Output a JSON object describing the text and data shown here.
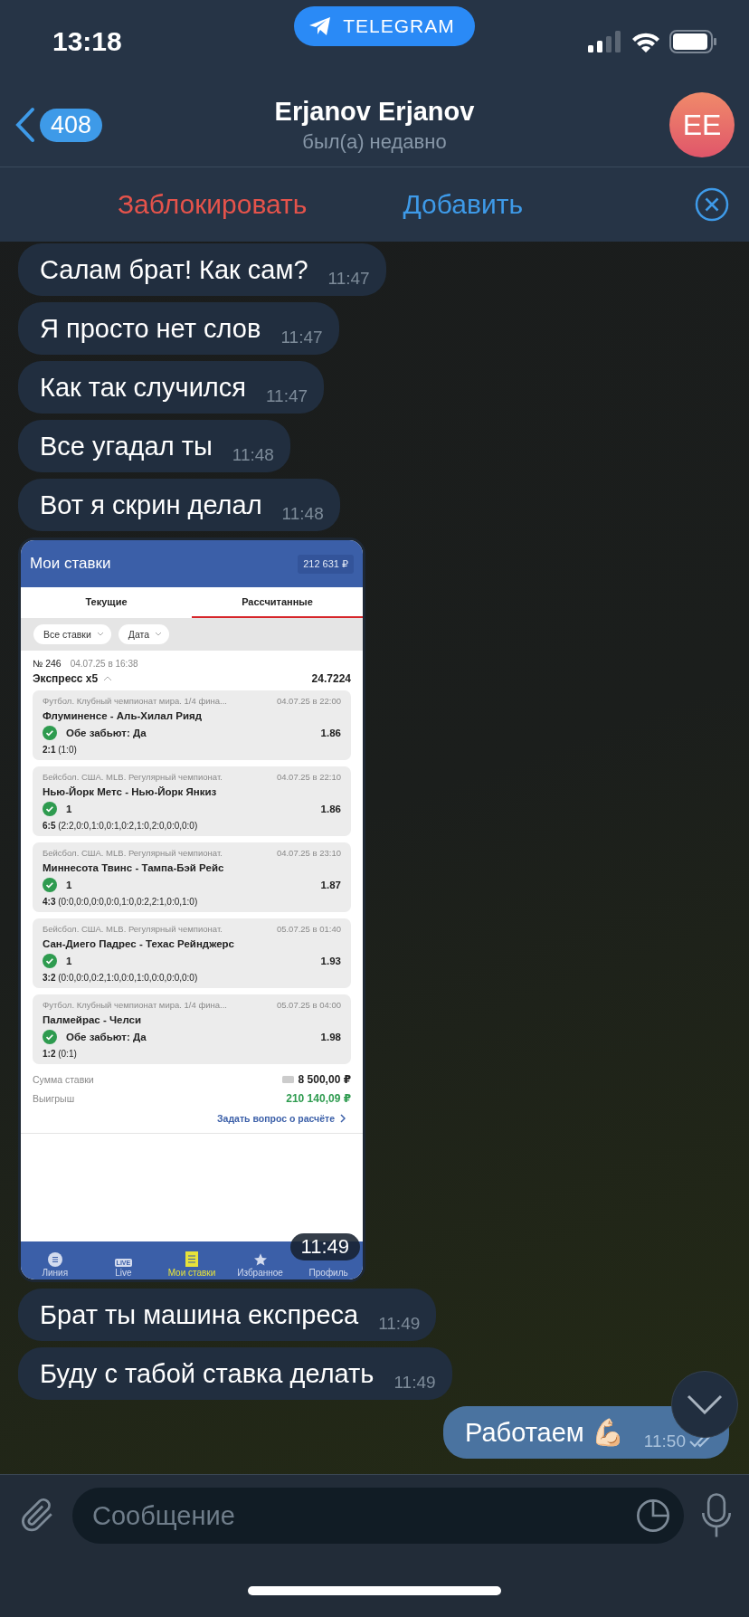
{
  "status_bar": {
    "time": "13:18",
    "app_pill": "TELEGRAM"
  },
  "header": {
    "back_count": "408",
    "name": "Erjanov Erjanov",
    "status": "был(а) недавно",
    "avatar_initials": "EE"
  },
  "action_bar": {
    "block": "Заблокировать",
    "add": "Добавить"
  },
  "messages": [
    {
      "kind": "text",
      "outgoing": false,
      "text": "Салам брат! Как сам?",
      "time": "11:47"
    },
    {
      "kind": "text",
      "outgoing": false,
      "text": "Я просто нет слов",
      "time": "11:47"
    },
    {
      "kind": "text",
      "outgoing": false,
      "text": "Как так случился",
      "time": "11:47"
    },
    {
      "kind": "text",
      "outgoing": false,
      "text": "Все угадал ты",
      "time": "11:48"
    },
    {
      "kind": "text",
      "outgoing": false,
      "text": "Вот я скрин делал",
      "time": "11:48"
    },
    {
      "kind": "screenshot",
      "outgoing": false,
      "time": "11:49",
      "screenshot": {
        "title": "Мои ставки",
        "balance": "212 631 ₽",
        "tabs": [
          {
            "label": "Текущие",
            "selected": false
          },
          {
            "label": "Рассчитанные",
            "selected": true
          }
        ],
        "filters": [
          "Все ставки",
          "Дата"
        ],
        "bet": {
          "number": "№ 246",
          "date": "04.07.25 в 16:38",
          "type": "Экспресс x5",
          "total_odds": "24.7224",
          "events": [
            {
              "league": "Футбол. Клубный чемпионат мира. 1/4 фина...",
              "date": "04.07.25 в 22:00",
              "teams": "Флуминенсе - Аль-Хилал Рияд",
              "pick": "Обе забьют: Да",
              "odds": "1.86",
              "score": "**2:1** (1:0)",
              "won": true
            },
            {
              "league": "Бейсбол. США. MLB. Регулярный чемпионат.",
              "date": "04.07.25 в 22:10",
              "teams": "Нью-Йорк Метс - Нью-Йорк Янкиз",
              "pick": "1",
              "odds": "1.86",
              "score": "**6:5** (2:2,0:0,1:0,0:1,0:2,1:0,2:0,0:0,0:0)",
              "won": true
            },
            {
              "league": "Бейсбол. США. MLB. Регулярный чемпионат.",
              "date": "04.07.25 в 23:10",
              "teams": "Миннесота Твинс - Тампа-Бэй Рейс",
              "pick": "1",
              "odds": "1.87",
              "score": "**4:3** (0:0,0:0,0:0,0:0,1:0,0:2,2:1,0:0,1:0)",
              "won": true
            },
            {
              "league": "Бейсбол. США. MLB. Регулярный чемпионат.",
              "date": "05.07.25 в 01:40",
              "teams": "Сан-Диего Падрес - Техас Рейнджерс",
              "pick": "1",
              "odds": "1.93",
              "score": "**3:2** (0:0,0:0,0:2,1:0,0:0,1:0,0:0,0:0,0:0)",
              "won": true
            },
            {
              "league": "Футбол. Клубный чемпионат мира. 1/4 фина...",
              "date": "05.07.25 в 04:00",
              "teams": "Палмейрас - Челси",
              "pick": "Обе забьют: Да",
              "odds": "1.98",
              "score": "**1:2** (0:1)",
              "won": true
            }
          ],
          "stake_label": "Сумма ставки",
          "stake": "8 500,00 ₽",
          "win_label": "Выигрыш",
          "win": "210 140,09 ₽",
          "link": "Задать вопрос о расчёте"
        },
        "nav": [
          {
            "kind": "list",
            "label": "Линия",
            "selected": false
          },
          {
            "kind": "live",
            "badge": "LIVE",
            "label": "Live",
            "selected": false
          },
          {
            "kind": "bets",
            "label": "Мои ставки",
            "selected": true
          },
          {
            "kind": "star",
            "label": "Избранное",
            "selected": false
          },
          {
            "kind": "profile",
            "label": "Профиль",
            "selected": false
          }
        ]
      }
    },
    {
      "kind": "text",
      "outgoing": false,
      "text": "Брат ты машина експреса",
      "time": "11:49"
    },
    {
      "kind": "text",
      "outgoing": false,
      "text": "Буду с табой ставка делать",
      "time": "11:49"
    },
    {
      "kind": "text",
      "outgoing": true,
      "text": "Работаем 💪🏻",
      "time": "11:50"
    }
  ],
  "composer": {
    "placeholder": "Сообщение"
  }
}
